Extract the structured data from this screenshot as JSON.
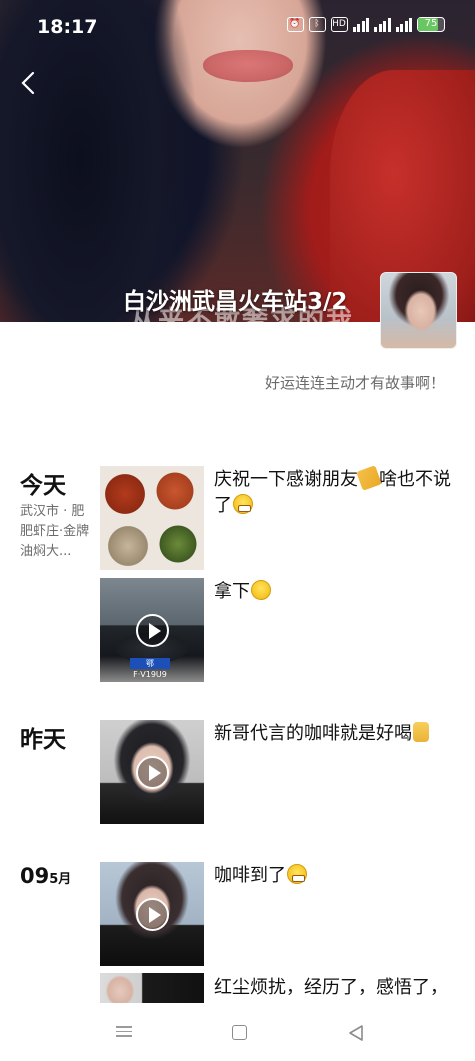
{
  "status_bar": {
    "time": "18:17",
    "battery": "75",
    "icons": [
      "alarm-icon",
      "bluetooth-icon",
      "hd-icon",
      "wifi-icon",
      "signal-icon",
      "signal-icon",
      "battery-icon"
    ]
  },
  "header": {
    "back_icon": "chevron-left-icon",
    "album_title": "白沙洲武昌火车站3/2",
    "cover_overlay_text": "从来不敢奢求的我"
  },
  "profile": {
    "signature": "好运连连主动才有故事啊！"
  },
  "feed": [
    {
      "date": "今天",
      "location": "武汉市 · 肥肥虾庄·金牌油焖大...",
      "posts": [
        {
          "text": "庆祝一下感谢朋友",
          "text_after": "啥也不说了",
          "emoji": [
            "pray",
            "grin"
          ],
          "media": "photo"
        },
        {
          "text": "拿下",
          "emoji": [
            "think"
          ],
          "media": "video",
          "plate": "鄂F·V19U9"
        }
      ]
    },
    {
      "date": "昨天",
      "posts": [
        {
          "text": "新哥代言的咖啡就是好喝",
          "emoji": [
            "victory"
          ],
          "media": "video"
        }
      ]
    },
    {
      "date_day": "09",
      "date_month": "5月",
      "posts": [
        {
          "text": "咖啡到了",
          "emoji": [
            "grin"
          ],
          "media": "video"
        },
        {
          "text": "红尘烦扰，经历了，感悟了，",
          "media": "photo"
        }
      ]
    }
  ],
  "nav_bar": {
    "items": [
      "menu-icon",
      "home-icon",
      "back-icon"
    ]
  }
}
